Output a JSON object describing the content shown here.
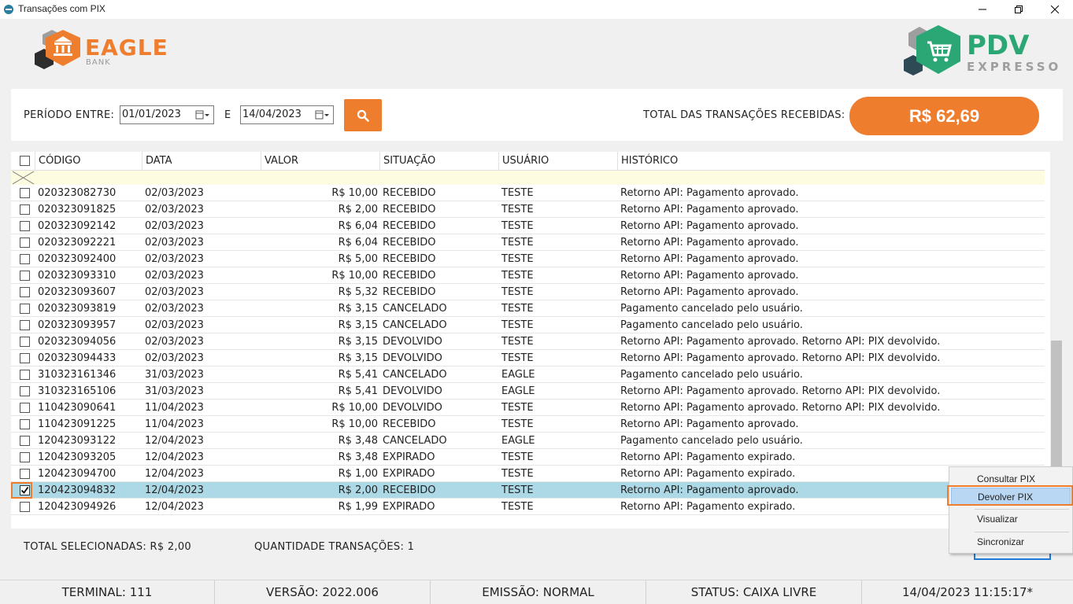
{
  "window": {
    "title": "Transações com PIX"
  },
  "logos": {
    "eagle_name": "EAGLE",
    "eagle_sub": "BANK",
    "pdv_name": "PDV",
    "pdv_sub": "EXPRESSO"
  },
  "filter": {
    "period_label": "PERÍODO ENTRE:",
    "date_from": "01/01/2023",
    "and_label": "E",
    "date_to": "14/04/2023",
    "total_label": "TOTAL DAS TRANSAÇÕES RECEBIDAS:",
    "total_value": "R$ 62,69"
  },
  "columns": [
    "CÓDIGO",
    "DATA",
    "VALOR",
    "SITUAÇÃO",
    "USUÁRIO",
    "HISTÓRICO"
  ],
  "rows": [
    {
      "codigo": "020323082730",
      "data": "02/03/2023",
      "valor": "R$ 10,00",
      "situacao": "RECEBIDO",
      "usuario": "TESTE",
      "historico": "Retorno API: Pagamento aprovado.",
      "checked": false
    },
    {
      "codigo": "020323091825",
      "data": "02/03/2023",
      "valor": "R$ 2,00",
      "situacao": "RECEBIDO",
      "usuario": "TESTE",
      "historico": "Retorno API: Pagamento aprovado.",
      "checked": false
    },
    {
      "codigo": "020323092142",
      "data": "02/03/2023",
      "valor": "R$ 6,04",
      "situacao": "RECEBIDO",
      "usuario": "TESTE",
      "historico": "Retorno API: Pagamento aprovado.",
      "checked": false
    },
    {
      "codigo": "020323092221",
      "data": "02/03/2023",
      "valor": "R$ 6,04",
      "situacao": "RECEBIDO",
      "usuario": "TESTE",
      "historico": "Retorno API: Pagamento aprovado.",
      "checked": false
    },
    {
      "codigo": "020323092400",
      "data": "02/03/2023",
      "valor": "R$ 5,00",
      "situacao": "RECEBIDO",
      "usuario": "TESTE",
      "historico": "Retorno API: Pagamento aprovado.",
      "checked": false
    },
    {
      "codigo": "020323093310",
      "data": "02/03/2023",
      "valor": "R$ 10,00",
      "situacao": "RECEBIDO",
      "usuario": "TESTE",
      "historico": "Retorno API: Pagamento aprovado.",
      "checked": false
    },
    {
      "codigo": "020323093607",
      "data": "02/03/2023",
      "valor": "R$ 5,32",
      "situacao": "RECEBIDO",
      "usuario": "TESTE",
      "historico": "Retorno API: Pagamento aprovado.",
      "checked": false
    },
    {
      "codigo": "020323093819",
      "data": "02/03/2023",
      "valor": "R$ 3,15",
      "situacao": "CANCELADO",
      "usuario": "TESTE",
      "historico": "Pagamento cancelado pelo usuário.",
      "checked": false
    },
    {
      "codigo": "020323093957",
      "data": "02/03/2023",
      "valor": "R$ 3,15",
      "situacao": "CANCELADO",
      "usuario": "TESTE",
      "historico": "Pagamento cancelado pelo usuário.",
      "checked": false
    },
    {
      "codigo": "020323094056",
      "data": "02/03/2023",
      "valor": "R$ 3,15",
      "situacao": "DEVOLVIDO",
      "usuario": "TESTE",
      "historico": "Retorno API: Pagamento aprovado. Retorno API: PIX devolvido.",
      "checked": false
    },
    {
      "codigo": "020323094433",
      "data": "02/03/2023",
      "valor": "R$ 3,15",
      "situacao": "DEVOLVIDO",
      "usuario": "TESTE",
      "historico": "Retorno API: Pagamento aprovado. Retorno API: PIX devolvido.",
      "checked": false
    },
    {
      "codigo": "310323161346",
      "data": "31/03/2023",
      "valor": "R$ 5,41",
      "situacao": "CANCELADO",
      "usuario": "EAGLE",
      "historico": "Pagamento cancelado pelo usuário.",
      "checked": false
    },
    {
      "codigo": "310323165106",
      "data": "31/03/2023",
      "valor": "R$ 5,41",
      "situacao": "DEVOLVIDO",
      "usuario": "EAGLE",
      "historico": "Retorno API: Pagamento aprovado. Retorno API: PIX devolvido.",
      "checked": false
    },
    {
      "codigo": "110423090641",
      "data": "11/04/2023",
      "valor": "R$ 10,00",
      "situacao": "DEVOLVIDO",
      "usuario": "TESTE",
      "historico": "Retorno API: Pagamento aprovado. Retorno API: PIX devolvido.",
      "checked": false
    },
    {
      "codigo": "110423091225",
      "data": "11/04/2023",
      "valor": "R$ 10,00",
      "situacao": "RECEBIDO",
      "usuario": "TESTE",
      "historico": "Retorno API: Pagamento aprovado.",
      "checked": false
    },
    {
      "codigo": "120423093122",
      "data": "12/04/2023",
      "valor": "R$ 3,48",
      "situacao": "CANCELADO",
      "usuario": "EAGLE",
      "historico": "Pagamento cancelado pelo usuário.",
      "checked": false
    },
    {
      "codigo": "120423093205",
      "data": "12/04/2023",
      "valor": "R$ 3,48",
      "situacao": "EXPIRADO",
      "usuario": "TESTE",
      "historico": "Retorno API: Pagamento expirado.",
      "checked": false
    },
    {
      "codigo": "120423094700",
      "data": "12/04/2023",
      "valor": "R$ 1,00",
      "situacao": "EXPIRADO",
      "usuario": "TESTE",
      "historico": "Retorno API: Pagamento expirado.",
      "checked": false
    },
    {
      "codigo": "120423094832",
      "data": "12/04/2023",
      "valor": "R$ 2,00",
      "situacao": "RECEBIDO",
      "usuario": "TESTE",
      "historico": "Retorno API: Pagamento aprovado.",
      "checked": true
    },
    {
      "codigo": "120423094926",
      "data": "12/04/2023",
      "valor": "R$ 1,99",
      "situacao": "EXPIRADO",
      "usuario": "TESTE",
      "historico": "Retorno API: Pagamento expirado.",
      "checked": false
    }
  ],
  "summary": {
    "total_selected": "TOTAL SELECIONADAS: R$ 2,00",
    "quantity": "QUANTIDADE TRANSAÇÕES: 1"
  },
  "context_menu": [
    "Consultar PIX",
    "Devolver PIX",
    "Visualizar",
    "Sincronizar"
  ],
  "statusbar": [
    "TERMINAL: 111",
    "VERSÃO: 2022.006",
    "EMISSÃO: NORMAL",
    "STATUS: CAIXA LIVRE",
    "14/04/2023 11:15:17*"
  ],
  "colors": {
    "accent": "#ef7d2e",
    "selected_row": "#add8e6",
    "pdv_green": "#2aa774"
  }
}
